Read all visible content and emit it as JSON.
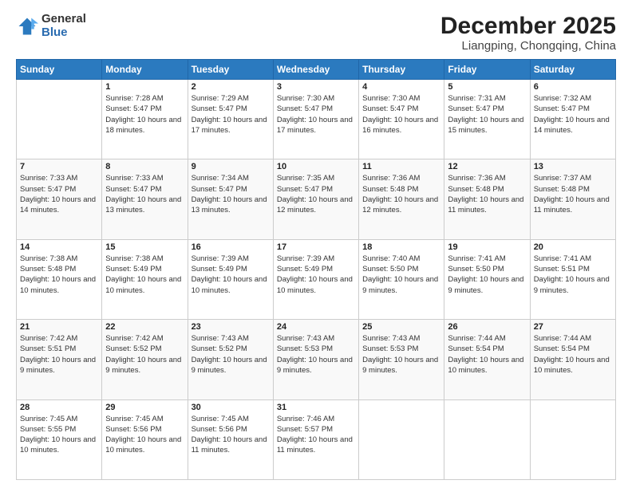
{
  "logo": {
    "general": "General",
    "blue": "Blue"
  },
  "title": "December 2025",
  "subtitle": "Liangping, Chongqing, China",
  "days_of_week": [
    "Sunday",
    "Monday",
    "Tuesday",
    "Wednesday",
    "Thursday",
    "Friday",
    "Saturday"
  ],
  "weeks": [
    [
      {
        "day": "",
        "sunrise": "",
        "sunset": "",
        "daylight": ""
      },
      {
        "day": "1",
        "sunrise": "Sunrise: 7:28 AM",
        "sunset": "Sunset: 5:47 PM",
        "daylight": "Daylight: 10 hours and 18 minutes."
      },
      {
        "day": "2",
        "sunrise": "Sunrise: 7:29 AM",
        "sunset": "Sunset: 5:47 PM",
        "daylight": "Daylight: 10 hours and 17 minutes."
      },
      {
        "day": "3",
        "sunrise": "Sunrise: 7:30 AM",
        "sunset": "Sunset: 5:47 PM",
        "daylight": "Daylight: 10 hours and 17 minutes."
      },
      {
        "day": "4",
        "sunrise": "Sunrise: 7:30 AM",
        "sunset": "Sunset: 5:47 PM",
        "daylight": "Daylight: 10 hours and 16 minutes."
      },
      {
        "day": "5",
        "sunrise": "Sunrise: 7:31 AM",
        "sunset": "Sunset: 5:47 PM",
        "daylight": "Daylight: 10 hours and 15 minutes."
      },
      {
        "day": "6",
        "sunrise": "Sunrise: 7:32 AM",
        "sunset": "Sunset: 5:47 PM",
        "daylight": "Daylight: 10 hours and 14 minutes."
      }
    ],
    [
      {
        "day": "7",
        "sunrise": "Sunrise: 7:33 AM",
        "sunset": "Sunset: 5:47 PM",
        "daylight": "Daylight: 10 hours and 14 minutes."
      },
      {
        "day": "8",
        "sunrise": "Sunrise: 7:33 AM",
        "sunset": "Sunset: 5:47 PM",
        "daylight": "Daylight: 10 hours and 13 minutes."
      },
      {
        "day": "9",
        "sunrise": "Sunrise: 7:34 AM",
        "sunset": "Sunset: 5:47 PM",
        "daylight": "Daylight: 10 hours and 13 minutes."
      },
      {
        "day": "10",
        "sunrise": "Sunrise: 7:35 AM",
        "sunset": "Sunset: 5:47 PM",
        "daylight": "Daylight: 10 hours and 12 minutes."
      },
      {
        "day": "11",
        "sunrise": "Sunrise: 7:36 AM",
        "sunset": "Sunset: 5:48 PM",
        "daylight": "Daylight: 10 hours and 12 minutes."
      },
      {
        "day": "12",
        "sunrise": "Sunrise: 7:36 AM",
        "sunset": "Sunset: 5:48 PM",
        "daylight": "Daylight: 10 hours and 11 minutes."
      },
      {
        "day": "13",
        "sunrise": "Sunrise: 7:37 AM",
        "sunset": "Sunset: 5:48 PM",
        "daylight": "Daylight: 10 hours and 11 minutes."
      }
    ],
    [
      {
        "day": "14",
        "sunrise": "Sunrise: 7:38 AM",
        "sunset": "Sunset: 5:48 PM",
        "daylight": "Daylight: 10 hours and 10 minutes."
      },
      {
        "day": "15",
        "sunrise": "Sunrise: 7:38 AM",
        "sunset": "Sunset: 5:49 PM",
        "daylight": "Daylight: 10 hours and 10 minutes."
      },
      {
        "day": "16",
        "sunrise": "Sunrise: 7:39 AM",
        "sunset": "Sunset: 5:49 PM",
        "daylight": "Daylight: 10 hours and 10 minutes."
      },
      {
        "day": "17",
        "sunrise": "Sunrise: 7:39 AM",
        "sunset": "Sunset: 5:49 PM",
        "daylight": "Daylight: 10 hours and 10 minutes."
      },
      {
        "day": "18",
        "sunrise": "Sunrise: 7:40 AM",
        "sunset": "Sunset: 5:50 PM",
        "daylight": "Daylight: 10 hours and 9 minutes."
      },
      {
        "day": "19",
        "sunrise": "Sunrise: 7:41 AM",
        "sunset": "Sunset: 5:50 PM",
        "daylight": "Daylight: 10 hours and 9 minutes."
      },
      {
        "day": "20",
        "sunrise": "Sunrise: 7:41 AM",
        "sunset": "Sunset: 5:51 PM",
        "daylight": "Daylight: 10 hours and 9 minutes."
      }
    ],
    [
      {
        "day": "21",
        "sunrise": "Sunrise: 7:42 AM",
        "sunset": "Sunset: 5:51 PM",
        "daylight": "Daylight: 10 hours and 9 minutes."
      },
      {
        "day": "22",
        "sunrise": "Sunrise: 7:42 AM",
        "sunset": "Sunset: 5:52 PM",
        "daylight": "Daylight: 10 hours and 9 minutes."
      },
      {
        "day": "23",
        "sunrise": "Sunrise: 7:43 AM",
        "sunset": "Sunset: 5:52 PM",
        "daylight": "Daylight: 10 hours and 9 minutes."
      },
      {
        "day": "24",
        "sunrise": "Sunrise: 7:43 AM",
        "sunset": "Sunset: 5:53 PM",
        "daylight": "Daylight: 10 hours and 9 minutes."
      },
      {
        "day": "25",
        "sunrise": "Sunrise: 7:43 AM",
        "sunset": "Sunset: 5:53 PM",
        "daylight": "Daylight: 10 hours and 9 minutes."
      },
      {
        "day": "26",
        "sunrise": "Sunrise: 7:44 AM",
        "sunset": "Sunset: 5:54 PM",
        "daylight": "Daylight: 10 hours and 10 minutes."
      },
      {
        "day": "27",
        "sunrise": "Sunrise: 7:44 AM",
        "sunset": "Sunset: 5:54 PM",
        "daylight": "Daylight: 10 hours and 10 minutes."
      }
    ],
    [
      {
        "day": "28",
        "sunrise": "Sunrise: 7:45 AM",
        "sunset": "Sunset: 5:55 PM",
        "daylight": "Daylight: 10 hours and 10 minutes."
      },
      {
        "day": "29",
        "sunrise": "Sunrise: 7:45 AM",
        "sunset": "Sunset: 5:56 PM",
        "daylight": "Daylight: 10 hours and 10 minutes."
      },
      {
        "day": "30",
        "sunrise": "Sunrise: 7:45 AM",
        "sunset": "Sunset: 5:56 PM",
        "daylight": "Daylight: 10 hours and 11 minutes."
      },
      {
        "day": "31",
        "sunrise": "Sunrise: 7:46 AM",
        "sunset": "Sunset: 5:57 PM",
        "daylight": "Daylight: 10 hours and 11 minutes."
      },
      {
        "day": "",
        "sunrise": "",
        "sunset": "",
        "daylight": ""
      },
      {
        "day": "",
        "sunrise": "",
        "sunset": "",
        "daylight": ""
      },
      {
        "day": "",
        "sunrise": "",
        "sunset": "",
        "daylight": ""
      }
    ]
  ]
}
